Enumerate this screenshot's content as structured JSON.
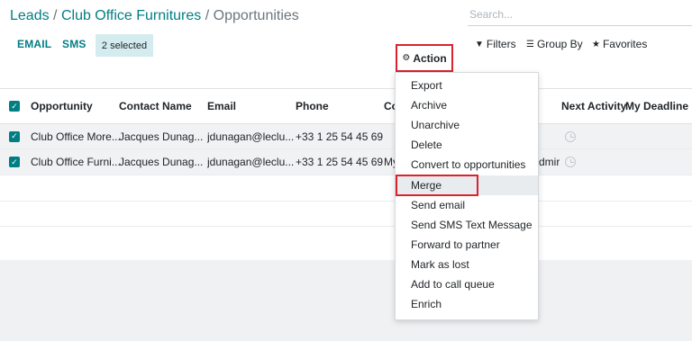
{
  "breadcrumb": {
    "items": [
      "Leads",
      "Club Office Furnitures"
    ],
    "current": "Opportunities",
    "separator": "/"
  },
  "search": {
    "placeholder": "Search..."
  },
  "toolbar": {
    "email_label": "EMAIL",
    "sms_label": "SMS",
    "selected_label": "2 selected",
    "action_label": "Action"
  },
  "filters": {
    "filters_label": "Filters",
    "groupby_label": "Group By",
    "favorites_label": "Favorites"
  },
  "table": {
    "columns": [
      "Opportunity",
      "Contact Name",
      "Email",
      "Phone",
      "Co",
      "Next Activity",
      "My Deadline"
    ],
    "rows": [
      {
        "opportunity": "Club Office More...",
        "contact": "Jacques Dunag...",
        "email": "jdunagan@leclu...",
        "phone": "+33 1 25 54 45 69",
        "company": "",
        "salesperson": "",
        "checked": true
      },
      {
        "opportunity": "Club Office Furni...",
        "contact": "Jacques Dunag...",
        "email": "jdunagan@leclu...",
        "phone": "+33 1 25 54 45 69",
        "company": "My",
        "salesperson": "dmir",
        "checked": true
      }
    ]
  },
  "action_menu": {
    "items": [
      "Export",
      "Archive",
      "Unarchive",
      "Delete",
      "Convert to opportunities",
      "Merge",
      "Send email",
      "Send SMS Text Message",
      "Forward to partner",
      "Mark as lost",
      "Add to call queue",
      "Enrich"
    ],
    "highlighted": "Merge"
  },
  "icons": {
    "action": "gear-icon",
    "filters": "funnel-icon",
    "groupby": "bars-icon",
    "favorites": "star-icon",
    "activity": "clock-icon",
    "checkbox": "check-icon"
  },
  "colors": {
    "accent": "#017e84",
    "highlight_box": "#d9232e",
    "selected_badge": "#d4ecef"
  }
}
